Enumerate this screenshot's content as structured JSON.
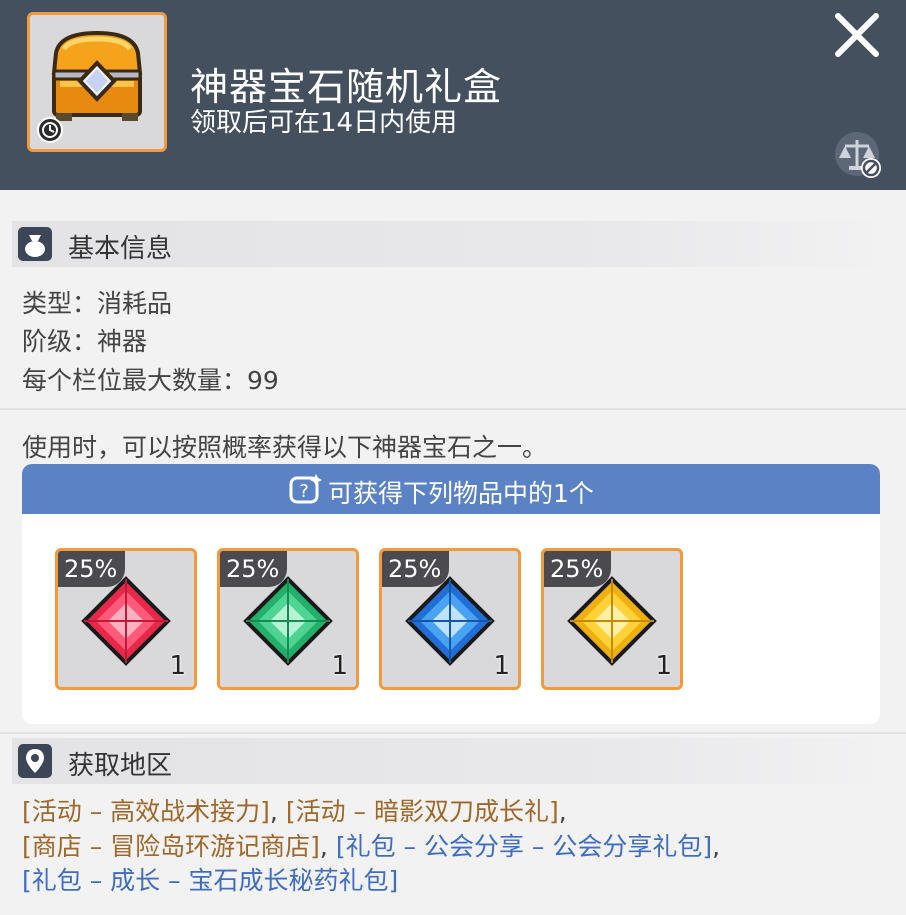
{
  "header": {
    "title": "神器宝石随机礼盒",
    "subtitle": "领取后可在14日内使用",
    "item_icon": "treasure-chest-icon",
    "colors": {
      "background": "#45505f",
      "frame": "#f29a3d"
    }
  },
  "basic_info": {
    "heading": "基本信息",
    "lines": [
      "类型：消耗品",
      "阶级：神器",
      "每个栏位最大数量：99"
    ]
  },
  "description": "使用时，可以按照概率获得以下神器宝石之一。",
  "rewards": {
    "heading": "可获得下列物品中的1个",
    "items": [
      {
        "gem": "red-gem-icon",
        "chance": "25%",
        "quantity": "1",
        "color": "#e8284a"
      },
      {
        "gem": "green-gem-icon",
        "chance": "25%",
        "quantity": "1",
        "color": "#2dc47a"
      },
      {
        "gem": "blue-gem-icon",
        "chance": "25%",
        "quantity": "1",
        "color": "#2f86e8"
      },
      {
        "gem": "yellow-gem-icon",
        "chance": "25%",
        "quantity": "1",
        "color": "#f5c21e"
      }
    ]
  },
  "acquisition": {
    "heading": "获取地区",
    "line1": {
      "a": "[活动 – 高效战术接力]",
      "sep1": ", ",
      "b": "[活动 – 暗影双刀成长礼]",
      "sep2": ","
    },
    "line2": {
      "a": "[商店 – 冒险岛环游记商店]",
      "sep1": ", ",
      "b": "[礼包 – 公会分享 – 公会分享礼包]",
      "sep2": ","
    },
    "line3": {
      "a": "[礼包 – 成长 – 宝石成长秘药礼包]"
    }
  }
}
